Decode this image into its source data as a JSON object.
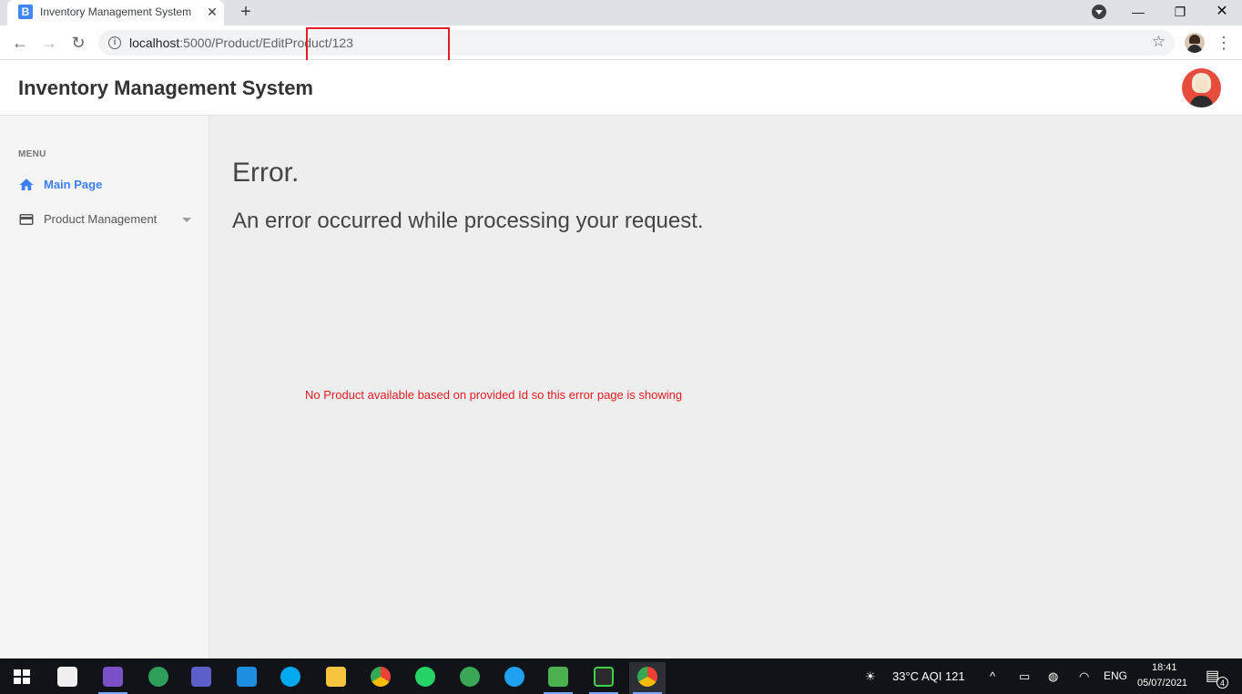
{
  "browser": {
    "tab_title": "Inventory Management System",
    "tab_favicon": "B",
    "url_host": "localhost",
    "url_path": ":5000/Product/EditProduct/123"
  },
  "app": {
    "title": "Inventory Management System"
  },
  "sidebar": {
    "menu_label": "MENU",
    "items": [
      {
        "label": "Main Page",
        "icon": "home-icon",
        "active": true
      },
      {
        "label": "Product Management",
        "icon": "card-icon",
        "active": false
      }
    ]
  },
  "main": {
    "heading": "Error.",
    "subheading": "An error occurred while processing your request.",
    "note": "No Product available based on provided Id so this error page is showing"
  },
  "taskbar": {
    "weather": "33°C  AQI 121",
    "language": "ENG",
    "time": "18:41",
    "date": "05/07/2021",
    "notification_count": "4"
  },
  "colors": {
    "accent": "#3d7ff1",
    "error": "#e31b23",
    "taskbar": "#101418"
  }
}
